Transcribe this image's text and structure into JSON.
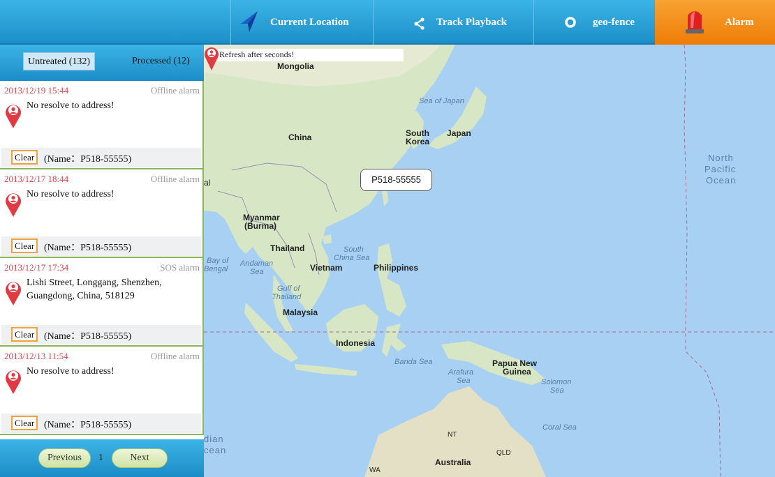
{
  "nav": {
    "current_location": "Current Location",
    "track_playback": "Track Playback",
    "geo_fence": "geo-fence",
    "alarm": "Alarm"
  },
  "tabs": {
    "untreated": "Untreated (132)",
    "processed": "Processed (12)"
  },
  "alarms": [
    {
      "time": "2013/12/19 15:44",
      "type": "Offline alarm",
      "address": "No resolve to address!",
      "clear": "Clear",
      "name": "(Name：P518-55555)"
    },
    {
      "time": "2013/12/17 18:44",
      "type": "Offline alarm",
      "address": "No resolve to address!",
      "clear": "Clear",
      "name": "(Name：P518-55555)"
    },
    {
      "time": "2013/12/17 17:34",
      "type": "SOS alarm",
      "address": "Lishi Street, Longgang, Shenzhen, Guangdong, China, 518129",
      "clear": "Clear",
      "name": "(Name：P518-55555)"
    },
    {
      "time": "2013/12/13 11:54",
      "type": "Offline alarm",
      "address": "No resolve to address!",
      "clear": "Clear",
      "name": "(Name：P518-55555)"
    }
  ],
  "pager": {
    "prev": "Previous",
    "page": "1",
    "next": "Next"
  },
  "map": {
    "refresh": "Refresh after seconds!",
    "device_label": "P518-55555",
    "labels": {
      "mongolia": "Mongolia",
      "sea_of_japan": "Sea of Japan",
      "china": "China",
      "south_korea_1": "South",
      "south_korea_2": "Korea",
      "japan": "Japan",
      "north_pacific_1": "North",
      "north_pacific_2": "Pacific",
      "north_pacific_3": "Ocean",
      "myanmar_1": "Myanmar",
      "myanmar_2": "(Burma)",
      "thailand": "Thailand",
      "scs_1": "South",
      "scs_2": "China Sea",
      "bay_1": "Bay of",
      "bay_2": "Bengal",
      "andaman_1": "Andaman",
      "andaman_2": "Sea",
      "vietnam": "Vietnam",
      "philippines": "Philippines",
      "gulf_1": "Gulf of",
      "gulf_2": "Thailand",
      "malaysia": "Malaysia",
      "indonesia": "Indonesia",
      "banda": "Banda Sea",
      "arafura_1": "Arafura",
      "arafura_2": "Sea",
      "png_1": "Papua New",
      "png_2": "Guinea",
      "solomon_1": "Solomon",
      "solomon_2": "Sea",
      "coral": "Coral Sea",
      "nt": "NT",
      "qld": "QLD",
      "australia": "Australia",
      "wa": "WA",
      "indian_1": "dian",
      "indian_2": "cean",
      "al": "al"
    }
  },
  "colors": {
    "nav_blue": "#1c8fc9",
    "alarm_orange": "#ee7c05",
    "alarm_red": "#e0414b",
    "divider_green": "#8cb560"
  }
}
